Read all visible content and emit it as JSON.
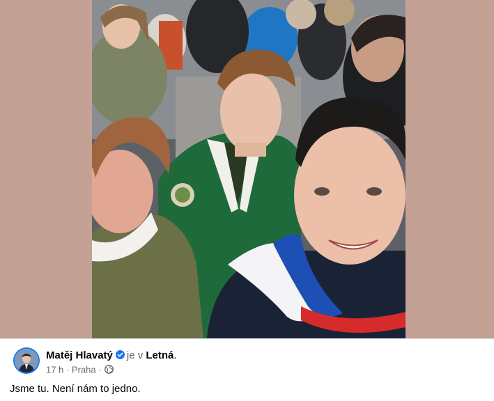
{
  "post": {
    "author": "Matěj Hlavatý",
    "connector": "je v",
    "location": "Letná",
    "location_suffix": ".",
    "time": "17 h",
    "separator": "·",
    "city": "Praha",
    "separator2": "·",
    "text": "Jsme tu. Není nám to jedno."
  },
  "icons": {
    "avatar": "profile-avatar",
    "verified": "verified-badge-icon",
    "audience": "globe-icon"
  },
  "colors": {
    "media_background": "#c3a195",
    "verified_blue": "#1877f2",
    "secondary_text": "#65676b",
    "primary_text": "#050505"
  }
}
